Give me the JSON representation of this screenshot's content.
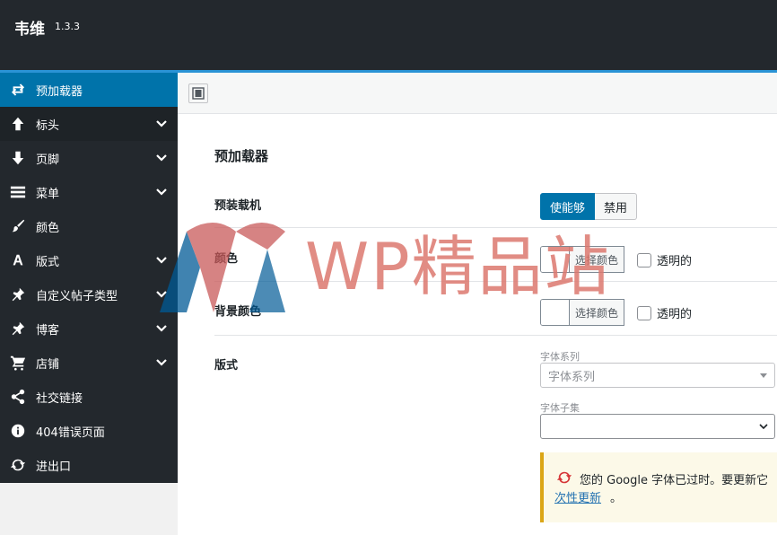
{
  "header": {
    "title": "韦维",
    "version": "1.3.3"
  },
  "sidebar": {
    "items": [
      {
        "label": "预加载器",
        "icon": "repeat-icon",
        "expandable": false
      },
      {
        "label": "标头",
        "icon": "arrow-up-icon",
        "expandable": true
      },
      {
        "label": "页脚",
        "icon": "arrow-down-icon",
        "expandable": true
      },
      {
        "label": "菜单",
        "icon": "menu-icon",
        "expandable": true
      },
      {
        "label": "颜色",
        "icon": "brush-icon",
        "expandable": false
      },
      {
        "label": "版式",
        "icon": "font-icon",
        "expandable": true
      },
      {
        "label": "自定义帖子类型",
        "icon": "pin-icon",
        "expandable": true
      },
      {
        "label": "博客",
        "icon": "pin-icon",
        "expandable": true
      },
      {
        "label": "店铺",
        "icon": "cart-icon",
        "expandable": true
      },
      {
        "label": "社交链接",
        "icon": "share-icon",
        "expandable": false
      },
      {
        "label": "404错误页面",
        "icon": "info-icon",
        "expandable": false
      },
      {
        "label": "进出口",
        "icon": "refresh-icon",
        "expandable": false
      }
    ]
  },
  "main": {
    "section_title": "预加载器",
    "preloader": {
      "label": "预装载机",
      "on_label": "使能够",
      "off_label": "禁用"
    },
    "color": {
      "label": "颜色",
      "pick_label": "选择颜色",
      "transparent_label": "透明的"
    },
    "bg_color": {
      "label": "背景颜色",
      "pick_label": "选择颜色",
      "transparent_label": "透明的"
    },
    "typography": {
      "label": "版式",
      "font_family_label": "字体系列",
      "font_family_placeholder": "字体系列",
      "font_subset_label": "字体子集",
      "font_subset_value": ""
    },
    "notice": {
      "text": "您的 Google 字体已过时。要更新它",
      "link": "次性更新",
      "end": "。"
    }
  },
  "watermark": "WP精品站",
  "colors": {
    "sidebar_bg": "#23282d",
    "active": "#0073aa",
    "notice_border": "#dba617"
  }
}
